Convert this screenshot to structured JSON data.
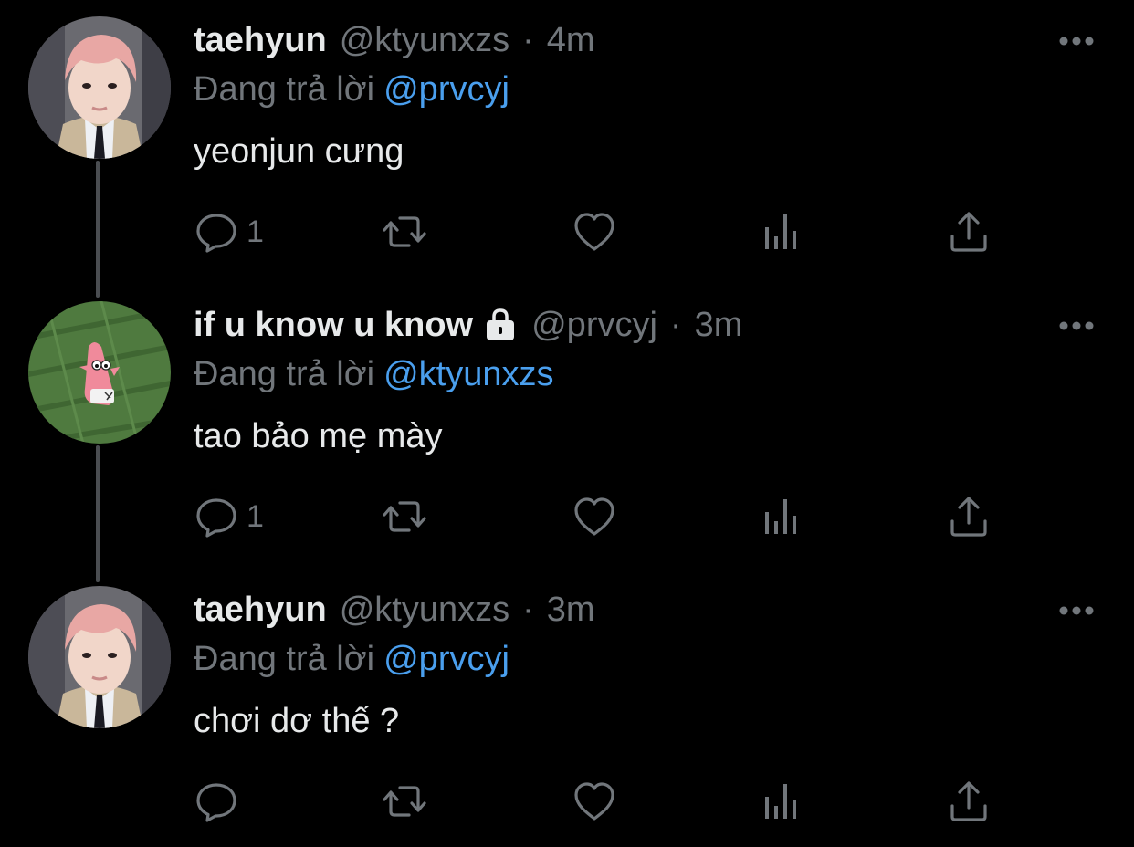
{
  "colors": {
    "background": "#000000",
    "primary_text": "#e7e9ea",
    "secondary_text": "#71767b",
    "mention": "#4a9fee",
    "thread_line": "#4a4d51"
  },
  "tweets": [
    {
      "avatar_icon": "avatar-photo",
      "display_name": "taehyun",
      "locked": false,
      "handle": "@ktyunxzs",
      "separator": "·",
      "time": "4m",
      "replying_label": "Đang trả lời",
      "replying_to": "@prvcyj",
      "text": "yeonjun cưng",
      "reply_count": "1",
      "retweet_count": "",
      "like_count": ""
    },
    {
      "avatar_icon": "avatar-cartoon",
      "display_name": "if u know u know",
      "locked": true,
      "handle": "@prvcyj",
      "separator": "·",
      "time": "3m",
      "replying_label": "Đang trả lời",
      "replying_to": "@ktyunxzs",
      "text": "tao bảo mẹ mày",
      "reply_count": "1",
      "retweet_count": "",
      "like_count": ""
    },
    {
      "avatar_icon": "avatar-photo",
      "display_name": "taehyun",
      "locked": false,
      "handle": "@ktyunxzs",
      "separator": "·",
      "time": "3m",
      "replying_label": "Đang trả lời",
      "replying_to": "@prvcyj",
      "text": "chơi dơ thế ?",
      "reply_count": "",
      "retweet_count": "",
      "like_count": ""
    }
  ],
  "icons": {
    "reply": "reply-icon",
    "retweet": "retweet-icon",
    "like": "heart-icon",
    "analytics": "analytics-icon",
    "share": "share-icon",
    "more": "more-icon",
    "lock": "lock-icon"
  }
}
